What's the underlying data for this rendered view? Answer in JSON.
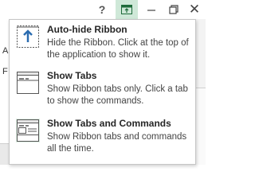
{
  "titlebar": {
    "help_label": "?",
    "close_label": "✕",
    "icons": [
      "help-icon",
      "ribbon-display-options-icon",
      "minimize-icon",
      "restore-icon",
      "close-icon"
    ],
    "active_color": "#cfe8d8"
  },
  "background": {
    "left_letters": [
      "A",
      "F"
    ]
  },
  "menu": {
    "items": [
      {
        "title": "Auto-hide Ribbon",
        "description": "Hide the Ribbon. Click at the top of the application to show it.",
        "icon": "auto-hide-ribbon-icon"
      },
      {
        "title": "Show Tabs",
        "description": "Show Ribbon tabs only. Click a tab to show the commands.",
        "icon": "show-tabs-icon"
      },
      {
        "title": "Show Tabs and Commands",
        "description": "Show Ribbon tabs and commands all the time.",
        "icon": "show-tabs-and-commands-icon"
      }
    ],
    "icon_accent": "#2b6cb0",
    "selected_fill": "#dff0e4"
  }
}
